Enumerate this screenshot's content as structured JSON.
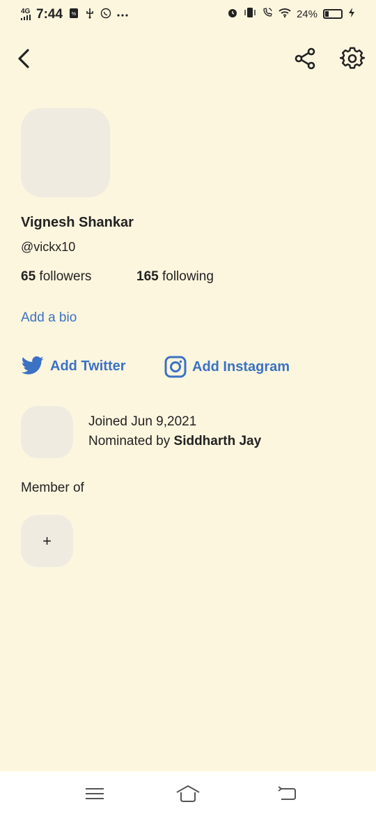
{
  "status_bar": {
    "network": "4G",
    "time": "7:44",
    "battery": "24%",
    "battery_level": 0.24,
    "icons": [
      "sim-icon",
      "usb-icon",
      "whatsapp-icon",
      "more-icon",
      "alarm-icon",
      "vibrate-icon",
      "wifi-call-icon",
      "wifi-icon",
      "battery-icon",
      "charging-icon"
    ]
  },
  "profile": {
    "name": "Vignesh Shankar",
    "handle": "@vickx10",
    "followers_count": "65",
    "followers_label": "followers",
    "following_count": "165",
    "following_label": "following",
    "add_bio": "Add a bio",
    "add_twitter": "Add Twitter",
    "add_instagram": "Add Instagram",
    "joined": "Joined Jun 9,2021",
    "nominated_prefix": "Nominated by",
    "nominated_by": "Siddharth Jay",
    "member_of": "Member of",
    "add_club": "+"
  },
  "colors": {
    "background": "#fdf6df",
    "accent": "#3a72c4",
    "placeholder": "#efebe1"
  }
}
